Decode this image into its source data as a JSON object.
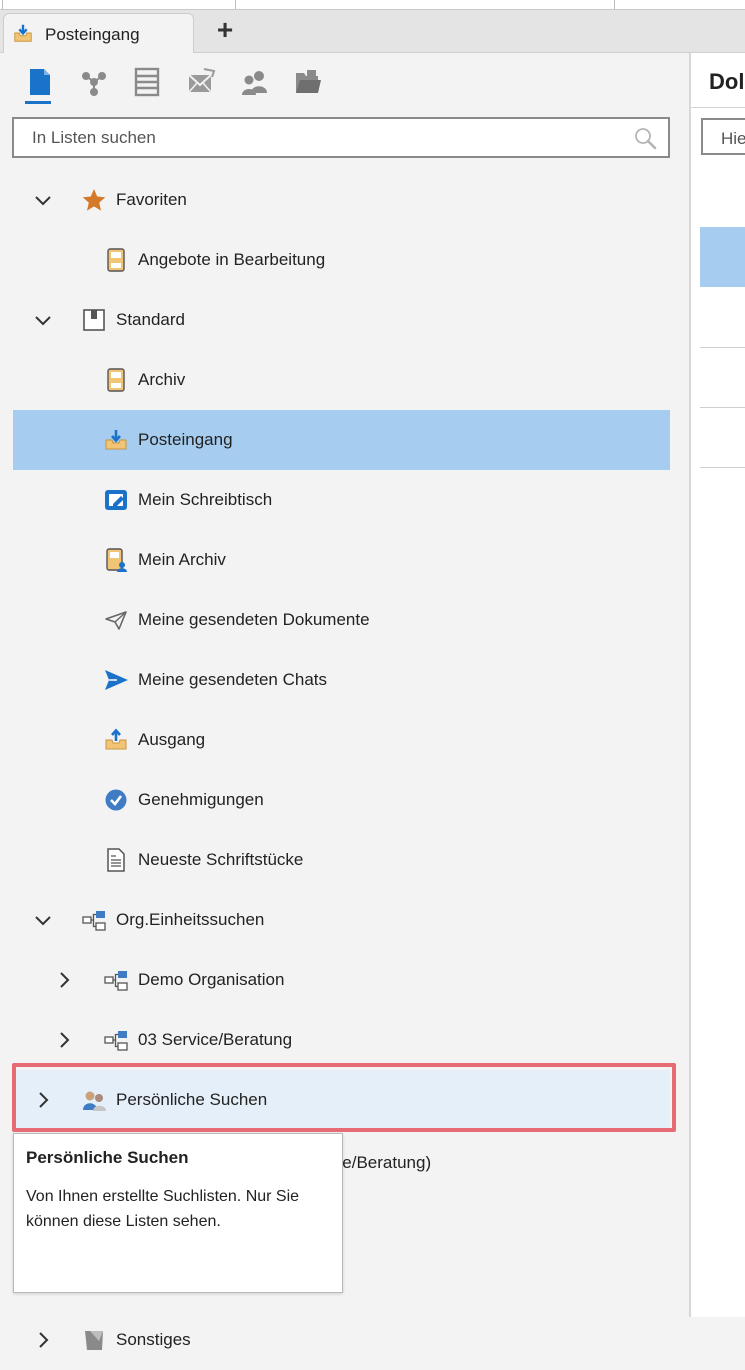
{
  "tab": {
    "label": "Posteingang"
  },
  "search": {
    "placeholder": "In Listen suchen"
  },
  "tree": {
    "favoriten": "Favoriten",
    "angebote": "Angebote in Bearbeitung",
    "standard": "Standard",
    "archiv": "Archiv",
    "posteingang": "Posteingang",
    "schreibtisch": "Mein Schreibtisch",
    "mein_archiv": "Mein Archiv",
    "gesendete_dokumente": "Meine gesendeten Dokumente",
    "gesendete_chats": "Meine gesendeten Chats",
    "ausgang": "Ausgang",
    "genehmigungen": "Genehmigungen",
    "neueste": "Neueste Schriftstücke",
    "org": "Org.Einheitssuchen",
    "demo_org": "Demo Organisation",
    "service": "03 Service/Beratung",
    "persoenlich": "Persönliche Suchen",
    "sonstiges": "Sonstiges"
  },
  "tooltip": {
    "title": "Persönliche Suchen",
    "body": "Von Ihnen erstellte Suchlisten. Nur Sie können diese Listen sehen."
  },
  "peek_text": "ice/Beratung)",
  "right": {
    "title": "Dol",
    "input_placeholder": "Hie"
  },
  "colors": {
    "selection": "#a6cdef",
    "hover": "#e5eff9",
    "accent": "#1a73c9",
    "highlight": "#e66b74"
  }
}
